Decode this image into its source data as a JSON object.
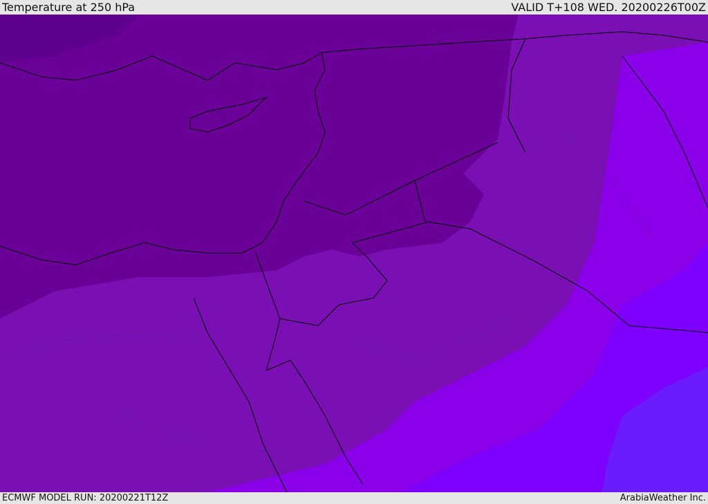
{
  "header": {
    "title": "Temperature at 250 hPa",
    "valid": "VALID T+108 WED. 20200226T00Z"
  },
  "footer": {
    "model_run": "ECMWF MODEL RUN: 20200221T12Z",
    "credit": "ArabiaWeather Inc."
  },
  "colors": {
    "band_coldest": "#5e0090",
    "band_cold": "#6a0098",
    "band_mid": "#7a10b4",
    "band_warm": "#8a00e8",
    "band_warmer": "#7a00ff",
    "band_warmest": "#6a1cff",
    "coast": "#000000"
  }
}
